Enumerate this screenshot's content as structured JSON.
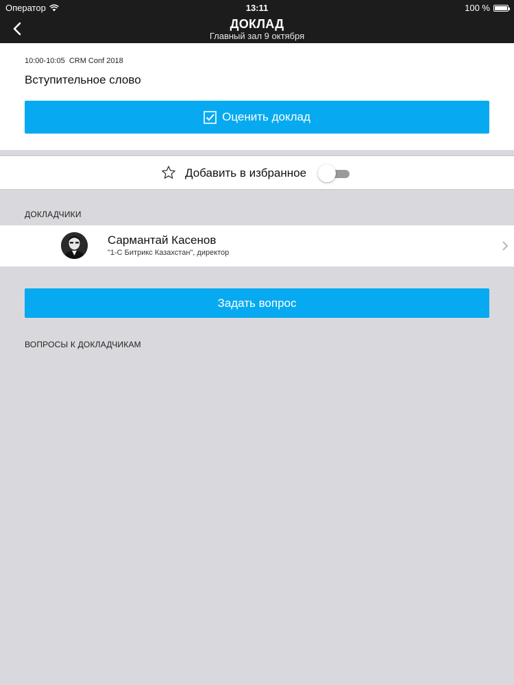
{
  "status_bar": {
    "carrier": "Оператор",
    "time": "13:11",
    "battery": "100 %"
  },
  "header": {
    "title": "ДОКЛАД",
    "subtitle": "Главный зал 9 октября"
  },
  "talk": {
    "meta": "10:00-10:05  CRM Conf 2018",
    "title": "Вступительное слово",
    "rate_label": "Оценить доклад"
  },
  "favorite": {
    "label": "Добавить в избранное",
    "enabled": false
  },
  "speakers": {
    "section_label": "ДОКЛАДЧИКИ",
    "items": [
      {
        "name": "Сармантай Касенов",
        "role": "\"1-С Битрикс Казахстан\", директор"
      }
    ]
  },
  "ask_label": "Задать вопрос",
  "questions": {
    "section_label": "ВОПРОСЫ К ДОКЛАДЧИКАМ"
  },
  "colors": {
    "accent": "#07aaf0",
    "header_bg": "#1c1c1c",
    "page_bg": "#d9d8dc"
  }
}
